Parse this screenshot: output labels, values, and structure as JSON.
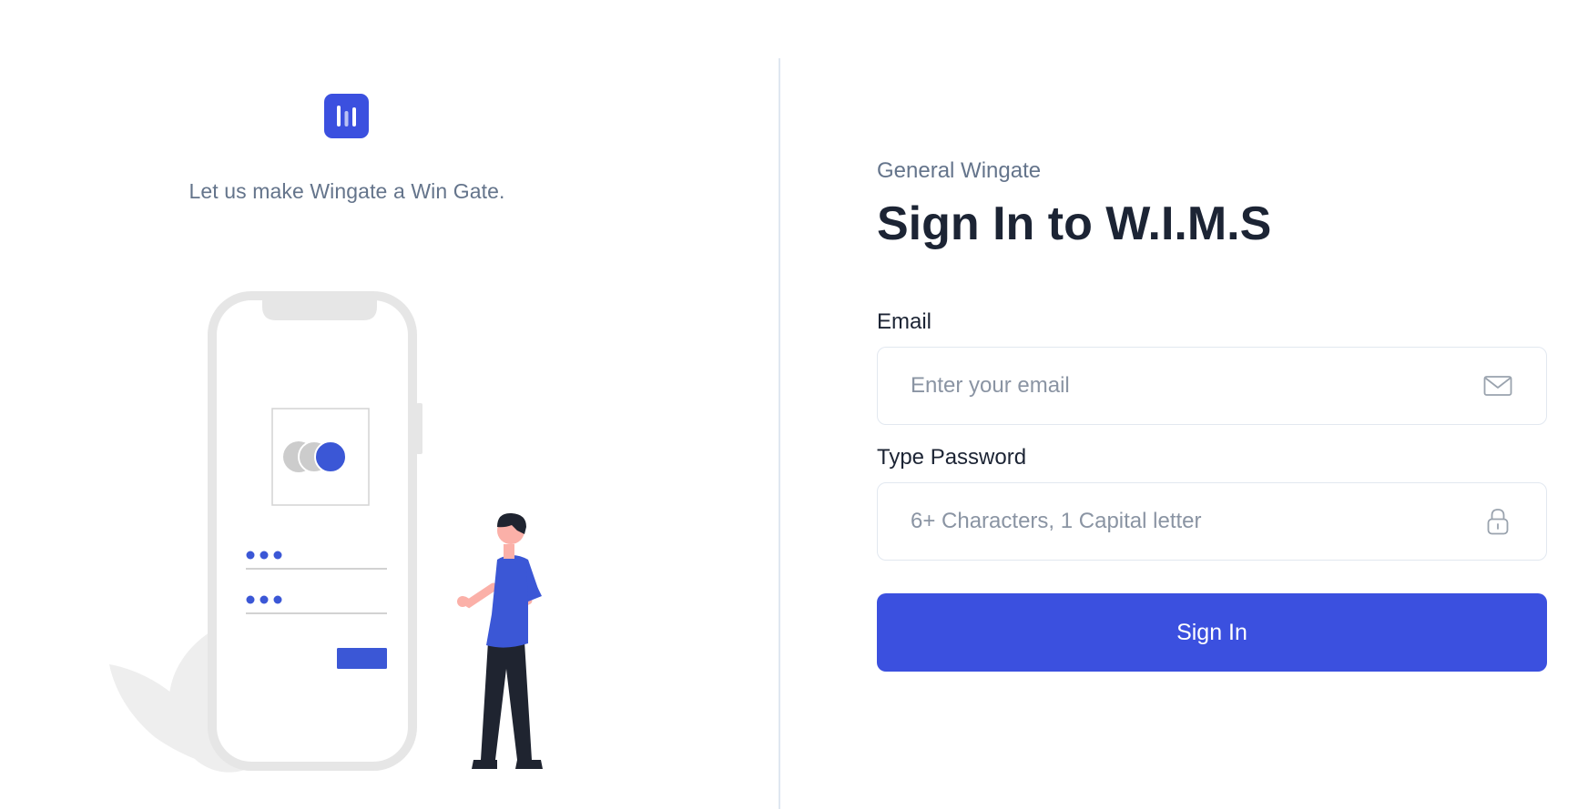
{
  "app": {
    "tagline": "Let us make Wingate a Win Gate.",
    "logo_icon": "bar-chart-icon"
  },
  "colors": {
    "accent": "#3b50df",
    "title": "#1c2434",
    "muted": "#64748b",
    "border": "#e2e8f0",
    "divider": "#dfe7f1"
  },
  "form": {
    "subtitle": "General Wingate",
    "title": "Sign In to W.I.M.S",
    "email": {
      "label": "Email",
      "placeholder": "Enter your email",
      "value": "",
      "icon": "mail-icon"
    },
    "password": {
      "label": "Type Password",
      "placeholder": "6+ Characters, 1 Capital letter",
      "value": "",
      "icon": "lock-icon"
    },
    "submit_label": "Sign In"
  }
}
